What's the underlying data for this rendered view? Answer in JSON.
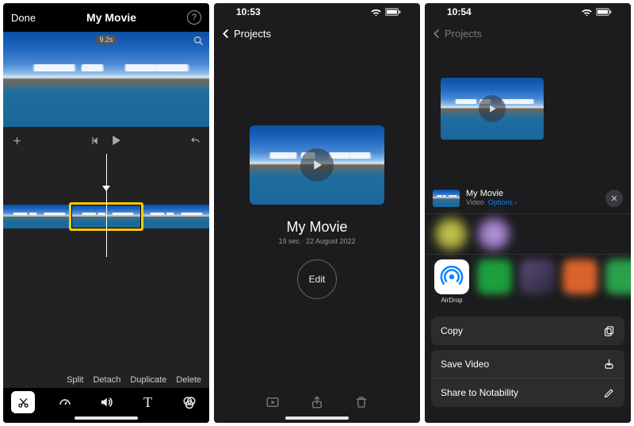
{
  "screen1": {
    "nav": {
      "done": "Done",
      "title": "My Movie",
      "help": "?"
    },
    "clip_duration": "9.2s",
    "edit_ops": {
      "split": "Split",
      "detach": "Detach",
      "duplicate": "Duplicate",
      "delete": "Delete"
    }
  },
  "screen2": {
    "status_time": "10:53",
    "back_label": "Projects",
    "project": {
      "title": "My Movie",
      "subtitle": "19 sec · 22 August 2022",
      "edit": "Edit"
    }
  },
  "screen3": {
    "status_time": "10:54",
    "back_label": "Projects",
    "share": {
      "title": "My Movie",
      "kind": "Video",
      "options": "Options",
      "airdrop": "AirDrop",
      "actions": {
        "copy": "Copy",
        "save_video": "Save Video",
        "share_notability": "Share to Notability"
      }
    }
  },
  "colors": {
    "accent_yellow": "#ffcc00",
    "ios_blue": "#0a84ff"
  }
}
